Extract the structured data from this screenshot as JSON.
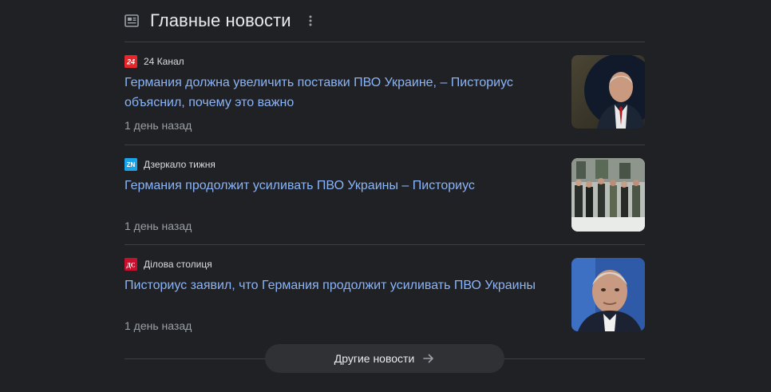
{
  "header": {
    "title": "Главные новости",
    "icon": "newspaper-icon",
    "more_icon": "more-vertical-icon"
  },
  "articles": [
    {
      "source": "24 Канал",
      "source_logo_text": "24",
      "source_logo_color": "#d32027",
      "headline": "Германия должна увеличить поставки ПВО Украине, – Писториус объяснил, почему это важно",
      "time": "1 день назад"
    },
    {
      "source": "Дзеркало тижня",
      "source_logo_text": "ZN",
      "source_logo_color": "#1aa3e8",
      "headline": "Германия продолжит усиливать ПВО Украины – Писториус",
      "time": "1 день назад"
    },
    {
      "source": "Ділова столиця",
      "source_logo_text": "ДС",
      "source_logo_color": "#c8102e",
      "headline": "Писториус заявил, что Германия продолжит усиливать ПВО Украины",
      "time": "1 день назад"
    }
  ],
  "more_button": {
    "label": "Другие новости",
    "icon": "arrow-right-icon"
  },
  "colors": {
    "background": "#202124",
    "link": "#8ab4f8",
    "text": "#e8eaed",
    "muted": "#9aa0a6",
    "divider": "#3c4043"
  }
}
